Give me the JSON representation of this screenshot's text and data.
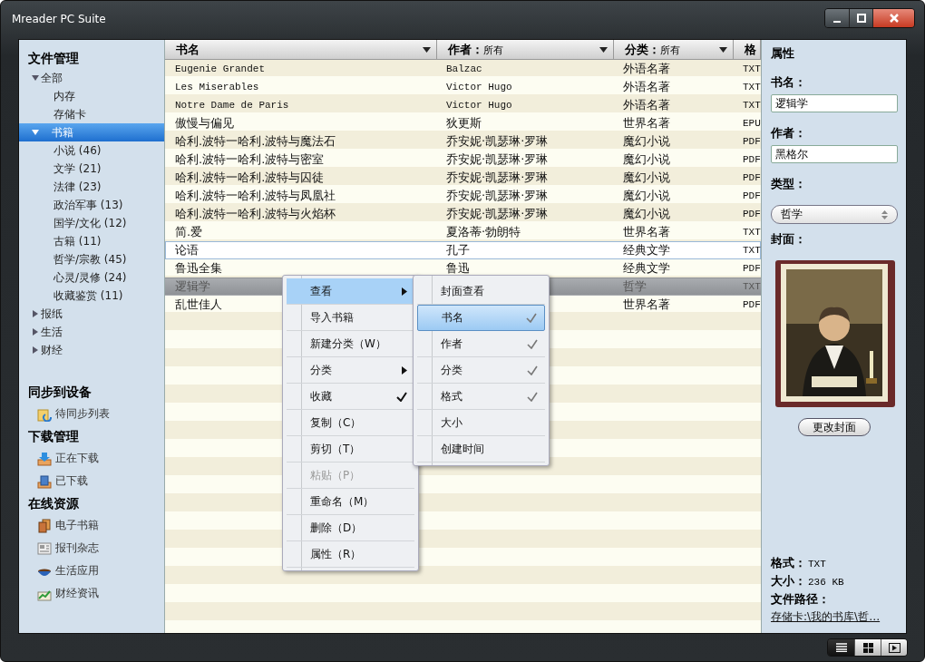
{
  "window": {
    "title": "Mreader PC Suite"
  },
  "sidebar": {
    "sections": [
      {
        "title": "文件管理",
        "kind": "tree",
        "items": [
          {
            "label": "全部",
            "expanded": true,
            "selected": false,
            "children": [
              {
                "label": "内存",
                "selected": false
              },
              {
                "label": "存储卡",
                "selected": false
              }
            ]
          },
          {
            "label": "书籍",
            "expanded": true,
            "selected": true,
            "children": [
              {
                "label": "小说 (46)",
                "selected": false
              },
              {
                "label": "文学 (21)",
                "selected": false
              },
              {
                "label": "法律 (23)",
                "selected": false
              },
              {
                "label": "政治军事 (13)",
                "selected": false
              },
              {
                "label": "国学/文化 (12)",
                "selected": false
              },
              {
                "label": "古籍 (11)",
                "selected": false
              },
              {
                "label": "哲学/宗教 (45)",
                "selected": false
              },
              {
                "label": "心灵/灵修 (24)",
                "selected": false
              },
              {
                "label": "收藏鉴赏 (11)",
                "selected": false
              }
            ]
          },
          {
            "label": "报纸",
            "expanded": false,
            "selected": false
          },
          {
            "label": "生活",
            "expanded": false,
            "selected": false
          },
          {
            "label": "财经",
            "expanded": false,
            "selected": false
          }
        ]
      },
      {
        "title": "同步到设备",
        "kind": "links",
        "items": [
          {
            "label": "待同步列表"
          }
        ]
      },
      {
        "title": "下载管理",
        "kind": "links",
        "items": [
          {
            "label": "正在下载"
          },
          {
            "label": "已下载"
          }
        ]
      },
      {
        "title": "在线资源",
        "kind": "links",
        "items": [
          {
            "label": "电子书籍"
          },
          {
            "label": "报刊杂志"
          },
          {
            "label": "生活应用"
          },
          {
            "label": "财经资讯"
          }
        ]
      }
    ]
  },
  "table": {
    "columns": [
      {
        "label": "书名"
      },
      {
        "label": "作者：",
        "filter": "所有"
      },
      {
        "label": "分类：",
        "filter": "所有"
      },
      {
        "label": "格"
      }
    ],
    "rows": [
      {
        "title": "Eugenie Grandet",
        "author": "Balzac",
        "category": "外语名著",
        "format": "TXT",
        "selected": false,
        "focused": false
      },
      {
        "title": "Les Miserables",
        "author": "Victor Hugo",
        "category": "外语名著",
        "format": "TXT",
        "selected": false,
        "focused": false
      },
      {
        "title": "Notre Dame de Paris",
        "author": "Victor Hugo",
        "category": "外语名著",
        "format": "TXT",
        "selected": false,
        "focused": false
      },
      {
        "title": "傲慢与偏见",
        "author": "狄更斯",
        "category": "世界名著",
        "format": "EPU",
        "selected": false,
        "focused": false
      },
      {
        "title": "哈利.波特一哈利.波特与魔法石",
        "author": "乔安妮·凯瑟琳·罗琳",
        "category": "魔幻小说",
        "format": "PDF",
        "selected": false,
        "focused": false
      },
      {
        "title": "哈利.波特一哈利.波特与密室",
        "author": "乔安妮·凯瑟琳·罗琳",
        "category": "魔幻小说",
        "format": "PDF",
        "selected": false,
        "focused": false
      },
      {
        "title": "哈利.波特一哈利.波特与囚徒",
        "author": "乔安妮·凯瑟琳·罗琳",
        "category": "魔幻小说",
        "format": "PDF",
        "selected": false,
        "focused": false
      },
      {
        "title": "哈利.波特一哈利.波特与凤凰社",
        "author": "乔安妮·凯瑟琳·罗琳",
        "category": "魔幻小说",
        "format": "PDF",
        "selected": false,
        "focused": false
      },
      {
        "title": "哈利.波特一哈利.波特与火焰杯",
        "author": "乔安妮·凯瑟琳·罗琳",
        "category": "魔幻小说",
        "format": "PDF",
        "selected": false,
        "focused": false
      },
      {
        "title": "简.爱",
        "author": "夏洛蒂·勃朗特",
        "category": "世界名著",
        "format": "TXT",
        "selected": false,
        "focused": false
      },
      {
        "title": "论语",
        "author": "孔子",
        "category": "经典文学",
        "format": "TXT",
        "selected": false,
        "focused": true
      },
      {
        "title": "鲁迅全集",
        "author": "鲁迅",
        "category": "经典文学",
        "format": "PDF",
        "selected": false,
        "focused": false
      },
      {
        "title": "逻辑学",
        "category": "哲学",
        "format": "TXT",
        "selected": true,
        "focused": false
      },
      {
        "title": "乱世佳人",
        "category": "世界名著",
        "format": "PDF",
        "selected": false,
        "focused": false
      }
    ]
  },
  "context_menu": {
    "items": [
      {
        "label": "查看",
        "submenu": true,
        "checked": false,
        "disabled": false,
        "selected": true
      },
      {
        "label": "导入书籍",
        "submenu": false,
        "checked": false,
        "disabled": false,
        "selected": false
      },
      {
        "label": "新建分类（W）",
        "submenu": false,
        "checked": false,
        "disabled": false,
        "selected": false
      },
      {
        "label": "分类",
        "submenu": true,
        "checked": false,
        "disabled": false,
        "selected": false
      },
      {
        "label": "收藏",
        "submenu": false,
        "checked": true,
        "disabled": false,
        "selected": false
      },
      {
        "label": "复制（C）",
        "submenu": false,
        "checked": false,
        "disabled": false,
        "selected": false
      },
      {
        "label": "剪切（T）",
        "submenu": false,
        "checked": false,
        "disabled": false,
        "selected": false
      },
      {
        "label": "粘贴（P）",
        "submenu": false,
        "checked": false,
        "disabled": true,
        "selected": false
      },
      {
        "label": "重命名（M）",
        "submenu": false,
        "checked": false,
        "disabled": false,
        "selected": false
      },
      {
        "label": "删除（D）",
        "submenu": false,
        "checked": false,
        "disabled": false,
        "selected": false
      },
      {
        "label": "属性（R）",
        "submenu": false,
        "checked": false,
        "disabled": false,
        "selected": false
      }
    ]
  },
  "submenu": {
    "items": [
      {
        "label": "封面查看",
        "checked": false,
        "selected": false
      },
      {
        "label": "书名",
        "checked": true,
        "selected": true
      },
      {
        "label": "作者",
        "checked": true,
        "selected": false
      },
      {
        "label": "分类",
        "checked": true,
        "selected": false
      },
      {
        "label": "格式",
        "checked": true,
        "selected": false
      },
      {
        "label": "大小",
        "checked": false,
        "selected": false
      },
      {
        "label": "创建时间",
        "checked": false,
        "selected": false
      }
    ]
  },
  "properties": {
    "title": "属性",
    "name_label": "书名：",
    "name_value": "逻辑学",
    "author_label": "作者：",
    "author_value": "黑格尔",
    "type_label": "类型：",
    "type_value": "哲学",
    "cover_label": "封面：",
    "change_cover_button": "更改封面",
    "format_label": "格式：",
    "format_value": "TXT",
    "size_label": "大小：",
    "size_value": "236 KB",
    "path_label": "文件路径：",
    "path_value": "存储卡:\\我的书库\\哲…"
  },
  "view_modes": [
    {
      "selected": true
    },
    {
      "selected": false
    },
    {
      "selected": false
    }
  ]
}
